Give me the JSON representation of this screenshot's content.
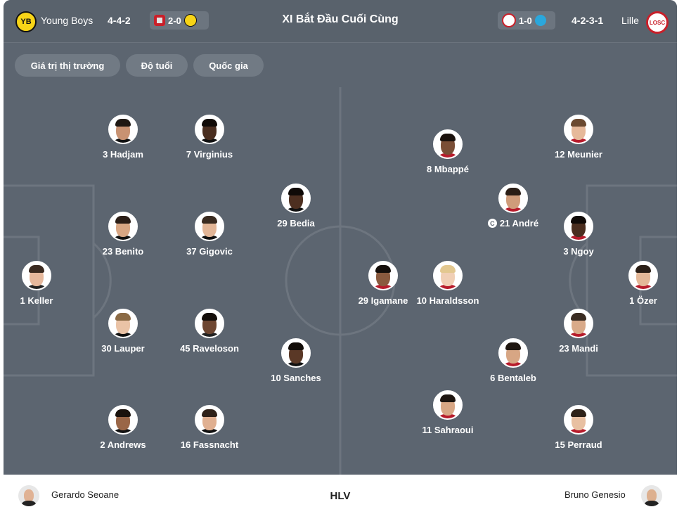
{
  "header": {
    "home_team": "Young Boys",
    "home_formation": "4-4-2",
    "home_last": {
      "score": "2-0",
      "opponent_icon": "sion-crest-icon",
      "team_icon": "young-boys-crest-icon"
    },
    "title": "XI Bắt Đầu Cuối Cùng",
    "away_last": {
      "score": "1-0",
      "team_icon": "lille-crest-icon",
      "opponent_icon": "marseille-crest-icon"
    },
    "away_formation": "4-2-3-1",
    "away_team": "Lille"
  },
  "filters": [
    "Giá trị thị trường",
    "Độ tuổi",
    "Quốc gia"
  ],
  "home_players": [
    {
      "id": "p1",
      "label": "1 Keller",
      "skin": "#e6b89c",
      "hair": "#3b2a20",
      "shirt": "#222222"
    },
    {
      "id": "p2",
      "label": "30 Lauper",
      "skin": "#eac3a6",
      "hair": "#8b6a45",
      "shirt": "#111111"
    },
    {
      "id": "p3",
      "label": "23 Benito",
      "skin": "#d8a683",
      "hair": "#2b1e17",
      "shirt": "#111111"
    },
    {
      "id": "p4",
      "label": "3 Hadjam",
      "skin": "#c89272",
      "hair": "#1f1813",
      "shirt": "#111111"
    },
    {
      "id": "p5",
      "label": "2 Andrews",
      "skin": "#9a6647",
      "hair": "#1a120d",
      "shirt": "#111111"
    },
    {
      "id": "p6",
      "label": "45 Raveloson",
      "skin": "#6e4631",
      "hair": "#140e0a",
      "shirt": "#222222"
    },
    {
      "id": "p7",
      "label": "37 Gigovic",
      "skin": "#e2b596",
      "hair": "#3a2b20",
      "shirt": "#111111"
    },
    {
      "id": "p8",
      "label": "7 Virginius",
      "skin": "#4a2e20",
      "hair": "#100a07",
      "shirt": "#111111"
    },
    {
      "id": "p9",
      "label": "16 Fassnacht",
      "skin": "#e0b091",
      "hair": "#2f2219",
      "shirt": "#111111"
    },
    {
      "id": "p10",
      "label": "10 Sanches",
      "skin": "#5a3826",
      "hair": "#120c08",
      "shirt": "#111111"
    },
    {
      "id": "p11",
      "label": "29 Bedia",
      "skin": "#4d2f20",
      "hair": "#0f0a07",
      "shirt": "#111111"
    }
  ],
  "away_players": [
    {
      "id": "a1",
      "label": "1 Özer",
      "skin": "#e4b898",
      "hair": "#2b1f17",
      "shirt": "#b71c2c"
    },
    {
      "id": "a2",
      "label": "23 Mandi",
      "skin": "#d9aa89",
      "hair": "#3a2c22",
      "shirt": "#b71c2c"
    },
    {
      "id": "a3",
      "label": "3 Ngoy",
      "skin": "#4b2e1f",
      "hair": "#100a07",
      "shirt": "#b71c2c"
    },
    {
      "id": "a4",
      "label": "15 Perraud",
      "skin": "#e8c0a2",
      "hair": "#2e2219",
      "shirt": "#b71c2c"
    },
    {
      "id": "a5",
      "label": "12 Meunier",
      "skin": "#e6b99a",
      "hair": "#6b4a30",
      "shirt": "#b71c2c"
    },
    {
      "id": "a6",
      "label": "21 André",
      "captain": "C",
      "skin": "#cf9c7a",
      "hair": "#2a1d15",
      "shirt": "#b71c2c"
    },
    {
      "id": "a7",
      "label": "6 Bentaleb",
      "skin": "#d7a684",
      "hair": "#1f1610",
      "shirt": "#b71c2c"
    },
    {
      "id": "a8",
      "label": "8 Mbappé",
      "skin": "#7a4e36",
      "hair": "#1b120d",
      "shirt": "#b71c2c"
    },
    {
      "id": "a9",
      "label": "10 Haraldsson",
      "skin": "#f0cfb5",
      "hair": "#e3c890",
      "shirt": "#b71c2c"
    },
    {
      "id": "a10",
      "label": "11 Sahraoui",
      "skin": "#d8a785",
      "hair": "#1d1510",
      "shirt": "#b71c2c"
    },
    {
      "id": "a11",
      "label": "29 Igamane",
      "skin": "#8a5a3e",
      "hair": "#150f0b",
      "shirt": "#b71c2c"
    }
  ],
  "coaches": {
    "label": "HLV",
    "home": "Gerardo Seoane",
    "away": "Bruno Genesio"
  }
}
